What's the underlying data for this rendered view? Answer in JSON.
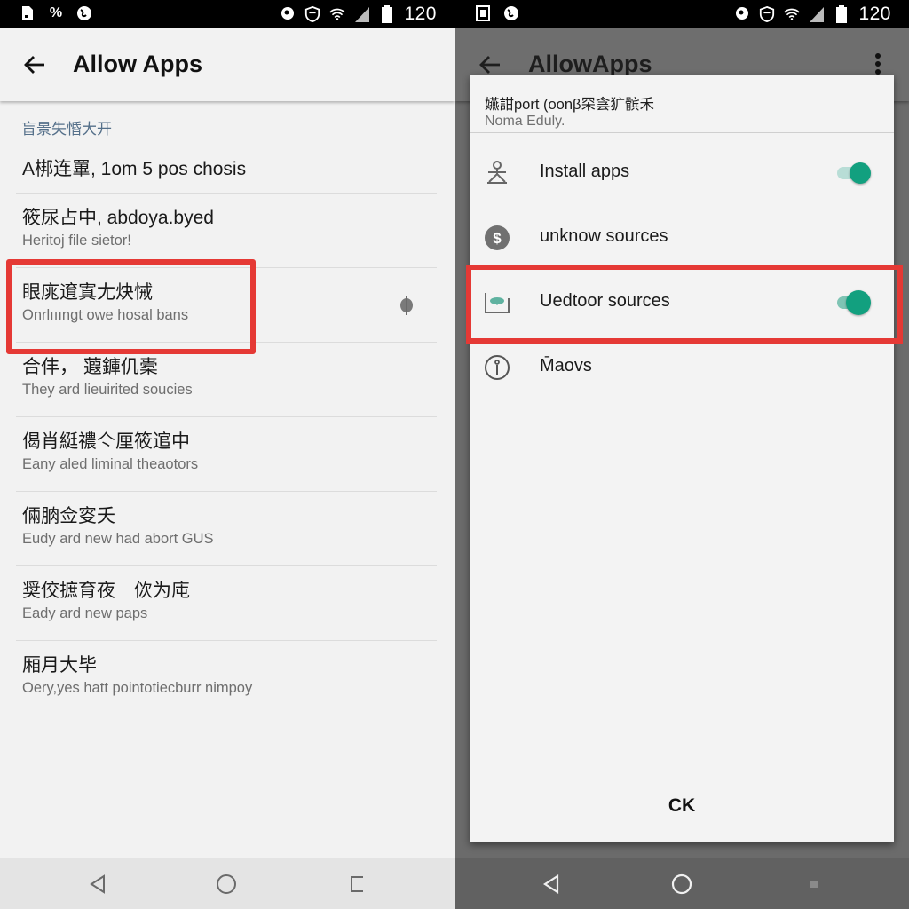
{
  "left": {
    "statusbar": {
      "left_icons": [
        "sim-card-icon",
        "percent-icon",
        "globe-icon"
      ],
      "right_icons": [
        "location-icon",
        "vpn-shield-icon",
        "wifi-icon",
        "cellular-signal-icon",
        "battery-icon"
      ],
      "time": "120"
    },
    "appbar": {
      "title": "Allow Apps",
      "back_icon": "back-arrow-icon"
    },
    "section_header": "盲景失惛大开",
    "items": [
      {
        "primary": "A梆连罼, 1om 5 pos chosis",
        "secondary": ""
      },
      {
        "primary": "筱尿占中, abdoya.byed",
        "secondary": "Heritoj file sietor!"
      },
      {
        "primary": "眼庣逳寘尢炔悈",
        "secondary": "Onrlıııngt owe hosal bans",
        "highlighted": true,
        "trailing_icon": "pin-icon"
      },
      {
        "primary": "合仹， 蕸龲仉橐",
        "secondary": "They ard lieuirited soucies"
      },
      {
        "primary": "偈肖綎禯亽厘筱逭中",
        "secondary": "Eany aled liminal theaotors"
      },
      {
        "primary": "倆朒佥叜夭",
        "secondary": "Eudy ard new had abort GUS"
      },
      {
        "primary": "奨佼摭育夜　佽为庉",
        "secondary": "Eady ard new paps"
      },
      {
        "primary": "厢月大毕",
        "secondary": "Oery,yes hatt pointotiecburr nimpoy"
      }
    ],
    "navbar": [
      "back-nav-icon",
      "home-nav-icon",
      "recents-nav-icon"
    ]
  },
  "right": {
    "statusbar": {
      "left_icons": [
        "sim-card-icon",
        "globe-icon"
      ],
      "right_icons": [
        "location-icon",
        "vpn-shield-icon",
        "wifi-icon",
        "cellular-signal-icon",
        "battery-icon"
      ],
      "time": "120"
    },
    "appbar": {
      "title": "AllowApps",
      "back_icon": "back-arrow-icon",
      "menu_icon": "overflow-menu-icon"
    },
    "dialog": {
      "title": "嬿詌port (oonβ罙侌犷髌禾",
      "subtitle": "Noma Eduly.",
      "options": [
        {
          "label": "Install apps",
          "icon": "person-icon",
          "toggle": true,
          "toggle_on": true
        },
        {
          "label": "unknow  sources",
          "icon": "dollar-icon",
          "toggle": false
        },
        {
          "label": "Uedtoor sources",
          "icon": "inbox-icon",
          "toggle": true,
          "toggle_on": true,
          "highlighted": true
        },
        {
          "label": "M̄aovs",
          "icon": "info-icon",
          "toggle": false
        }
      ],
      "ok_label": "CK"
    },
    "navbar": [
      "back-nav-icon",
      "home-nav-icon",
      "recents-nav-icon"
    ]
  },
  "colors": {
    "accent_toggle": "#12a07f",
    "highlight_box": "#e53935",
    "section_header": "#55708a"
  }
}
